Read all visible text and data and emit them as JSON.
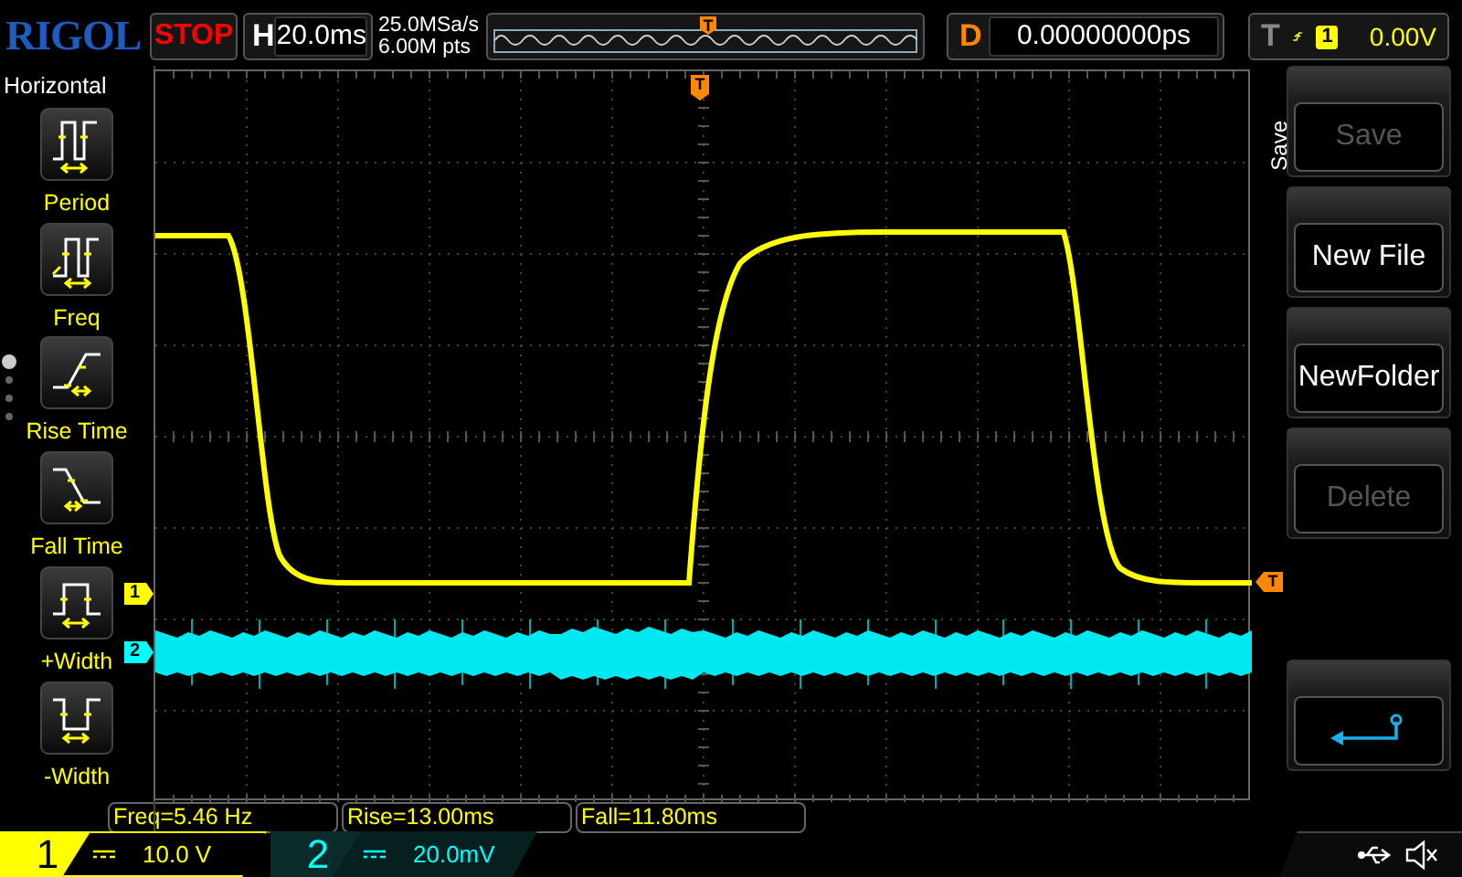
{
  "header": {
    "logo": "RIGOL",
    "run_state": "STOP",
    "timebase_label": "H",
    "timebase": "20.0ms",
    "sample_rate": "25.0MSa/s",
    "memory_depth": "6.00M pts",
    "overview_marker": "T",
    "delay_label": "D",
    "delay": "0.00000000ps",
    "trigger_label": "T",
    "trigger_source": "1",
    "trigger_level": "0.00V"
  },
  "left_menu": {
    "title": "Horizontal",
    "page_dots": [
      {
        "selected": true
      },
      {
        "selected": false
      },
      {
        "selected": false
      },
      {
        "selected": false
      }
    ],
    "items": [
      {
        "kind": "period",
        "label": "Period"
      },
      {
        "kind": "freq",
        "label": "Freq"
      },
      {
        "kind": "rise",
        "label": "Rise Time"
      },
      {
        "kind": "fall",
        "label": "Fall Time"
      },
      {
        "kind": "pos_width",
        "label": "+Width"
      },
      {
        "kind": "neg_width",
        "label": "-Width"
      }
    ]
  },
  "display": {
    "channel_markers": [
      {
        "label": "1",
        "color": "#ffff00"
      },
      {
        "label": "2",
        "color": "#00ffff"
      }
    ],
    "trigger_markers": [
      {
        "label": "T"
      },
      {
        "label": "T"
      }
    ]
  },
  "measurements": [
    "Freq=5.46 Hz",
    "Rise=13.00ms",
    "Fall=11.80ms"
  ],
  "right_menu": {
    "title": "Save",
    "buttons": [
      {
        "kind": "text",
        "label": "Save",
        "disabled": true
      },
      {
        "kind": "text",
        "label": "New File",
        "disabled": false
      },
      {
        "kind": "text",
        "label": "NewFolder",
        "disabled": false
      },
      {
        "kind": "text",
        "label": "Delete",
        "disabled": true
      },
      {
        "kind": "back"
      }
    ]
  },
  "channels": [
    {
      "number": "1",
      "scale": "10.0 V",
      "color": "#ffff00",
      "active": true
    },
    {
      "number": "2",
      "scale": "20.0mV",
      "color": "#00ffff",
      "active": false
    }
  ]
}
